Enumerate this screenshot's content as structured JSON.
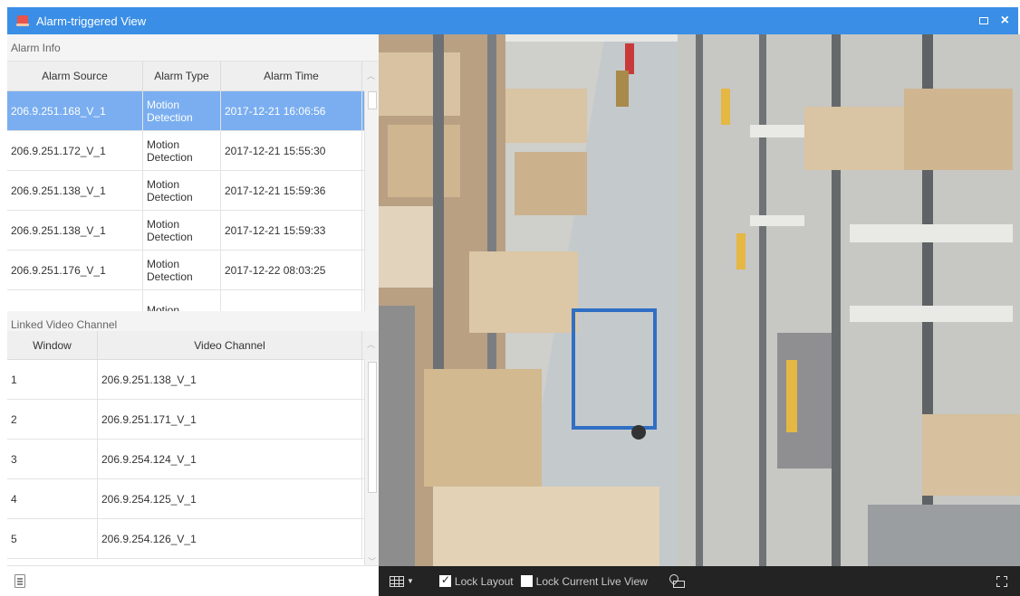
{
  "window": {
    "title": "Alarm-triggered View"
  },
  "alarm_info": {
    "label": "Alarm Info",
    "columns": [
      "Alarm Source",
      "Alarm Type",
      "Alarm Time"
    ],
    "rows": [
      {
        "source": "206.9.251.168_V_1",
        "type": "Motion Detection",
        "time": "2017-12-21 16:06:56",
        "selected": true
      },
      {
        "source": "206.9.251.172_V_1",
        "type": "Motion Detection",
        "time": "2017-12-21 15:55:30"
      },
      {
        "source": "206.9.251.138_V_1",
        "type": "Motion Detection",
        "time": "2017-12-21 15:59:36"
      },
      {
        "source": "206.9.251.138_V_1",
        "type": "Motion Detection",
        "time": "2017-12-21 15:59:33"
      },
      {
        "source": "206.9.251.176_V_1",
        "type": "Motion Detection",
        "time": "2017-12-22 08:03:25"
      },
      {
        "source": "",
        "type": "Motion",
        "time": ""
      }
    ]
  },
  "linked_video": {
    "label": "Linked Video Channel",
    "columns": [
      "Window",
      "Video Channel"
    ],
    "rows": [
      {
        "window": "1",
        "channel": "206.9.251.138_V_1"
      },
      {
        "window": "2",
        "channel": "206.9.251.171_V_1"
      },
      {
        "window": "3",
        "channel": "206.9.254.124_V_1"
      },
      {
        "window": "4",
        "channel": "206.9.254.125_V_1"
      },
      {
        "window": "5",
        "channel": "206.9.254.126_V_1"
      }
    ]
  },
  "toolbar": {
    "lock_layout": "Lock Layout",
    "lock_layout_checked": true,
    "lock_live_view": "Lock Current Live View",
    "lock_live_view_checked": false
  },
  "colors": {
    "title_bar": "#3a8ee6",
    "selected_row": "#7aaef0",
    "toolbar": "#232323"
  }
}
